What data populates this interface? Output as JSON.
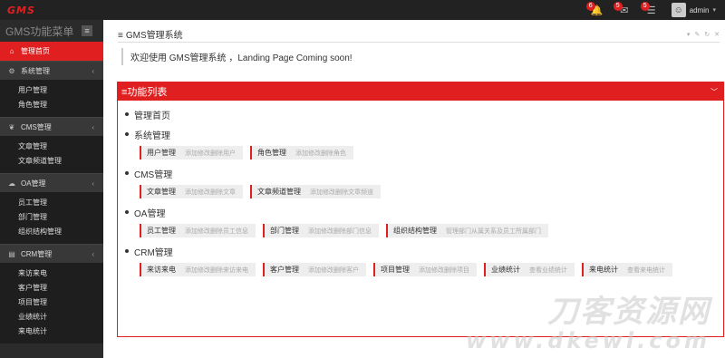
{
  "topbar": {
    "logo": "GMS",
    "badges": [
      "6",
      "5",
      "5"
    ],
    "user": "admin"
  },
  "sidebar": {
    "title": "GMS功能菜单",
    "toggle": "≡",
    "items": [
      {
        "label": "管理首页",
        "icon": "home-icon",
        "active": true
      },
      {
        "label": "系统管理",
        "icon": "gear-icon",
        "subs": [
          "用户管理",
          "角色管理"
        ]
      },
      {
        "label": "CMS管理",
        "icon": "leaf-icon",
        "subs": [
          "文章管理",
          "文章频道管理"
        ]
      },
      {
        "label": "OA管理",
        "icon": "cloud-icon",
        "subs": [
          "员工管理",
          "部门管理",
          "组织结构管理"
        ]
      },
      {
        "label": "CRM管理",
        "icon": "list-icon",
        "subs": [
          "来访来电",
          "客户管理",
          "项目管理",
          "业绩统计",
          "来电统计"
        ]
      }
    ]
  },
  "main": {
    "portlet1": {
      "title": "GMS管理系统",
      "welcome": "欢迎使用 GMS管理系统 ，Landing Page Coming soon!"
    },
    "portlet2": {
      "title": "功能列表",
      "sections": [
        {
          "title": "管理首页",
          "tiles": []
        },
        {
          "title": "系统管理",
          "tiles": [
            {
              "name": "用户管理",
              "desc": "添加修改删除用户"
            },
            {
              "name": "角色管理",
              "desc": "添加修改删除角色"
            }
          ]
        },
        {
          "title": "CMS管理",
          "tiles": [
            {
              "name": "文章管理",
              "desc": "添加修改删除文章"
            },
            {
              "name": "文章频道管理",
              "desc": "添加修改删除文章频道"
            }
          ]
        },
        {
          "title": "OA管理",
          "tiles": [
            {
              "name": "员工管理",
              "desc": "添加修改删除员工信息"
            },
            {
              "name": "部门管理",
              "desc": "添加修改删除部门信息"
            },
            {
              "name": "组织结构管理",
              "desc": "管理部门从属关系及员工所属部门"
            }
          ]
        },
        {
          "title": "CRM管理",
          "tiles": [
            {
              "name": "来访来电",
              "desc": "添加修改删除来访来电"
            },
            {
              "name": "客户管理",
              "desc": "添加修改删除客户"
            },
            {
              "name": "项目管理",
              "desc": "添加修改删除项目"
            },
            {
              "name": "业绩统计",
              "desc": "查看业绩统计"
            },
            {
              "name": "来电统计",
              "desc": "查看来电统计"
            }
          ]
        }
      ]
    }
  },
  "watermark": {
    "line1": "刀客资源网",
    "line2": "www.dkewl.com"
  },
  "colors": {
    "accent": "#e02020",
    "sidebar": "#2b2b2b",
    "topbar": "#222222"
  }
}
